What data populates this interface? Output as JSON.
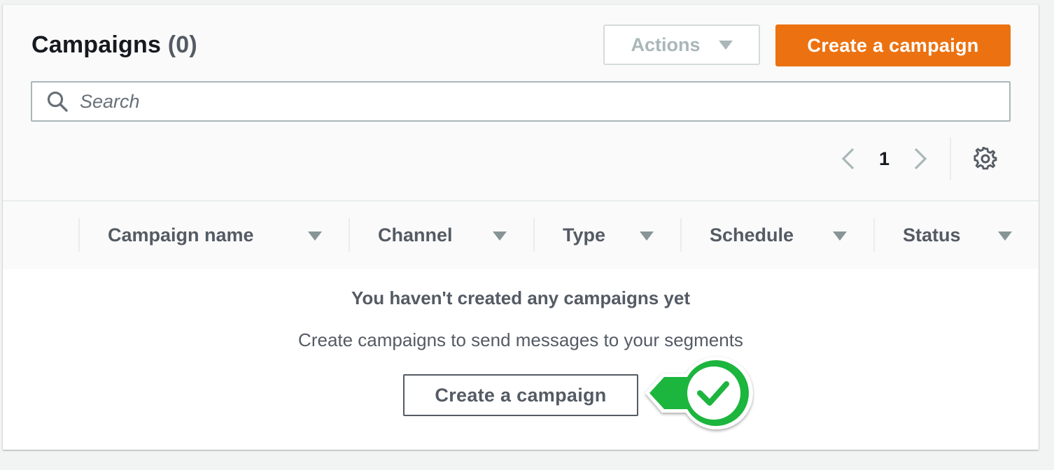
{
  "header": {
    "title": "Campaigns",
    "count": "(0)",
    "actions_label": "Actions",
    "create_label": "Create a campaign"
  },
  "search": {
    "placeholder": "Search"
  },
  "pagination": {
    "current_page": "1"
  },
  "table": {
    "columns": [
      "Campaign name",
      "Channel",
      "Type",
      "Schedule",
      "Status"
    ]
  },
  "empty_state": {
    "title": "You haven't created any campaigns yet",
    "subtitle": "Create campaigns to send messages to your segments",
    "button_label": "Create a campaign"
  },
  "colors": {
    "primary_button": "#ec7211",
    "check_badge": "#1db53e"
  },
  "icons": [
    "search-icon",
    "chevron-down-icon",
    "chevron-left-icon",
    "chevron-right-icon",
    "gear-icon",
    "sort-caret-icon",
    "checkmark-icon"
  ]
}
